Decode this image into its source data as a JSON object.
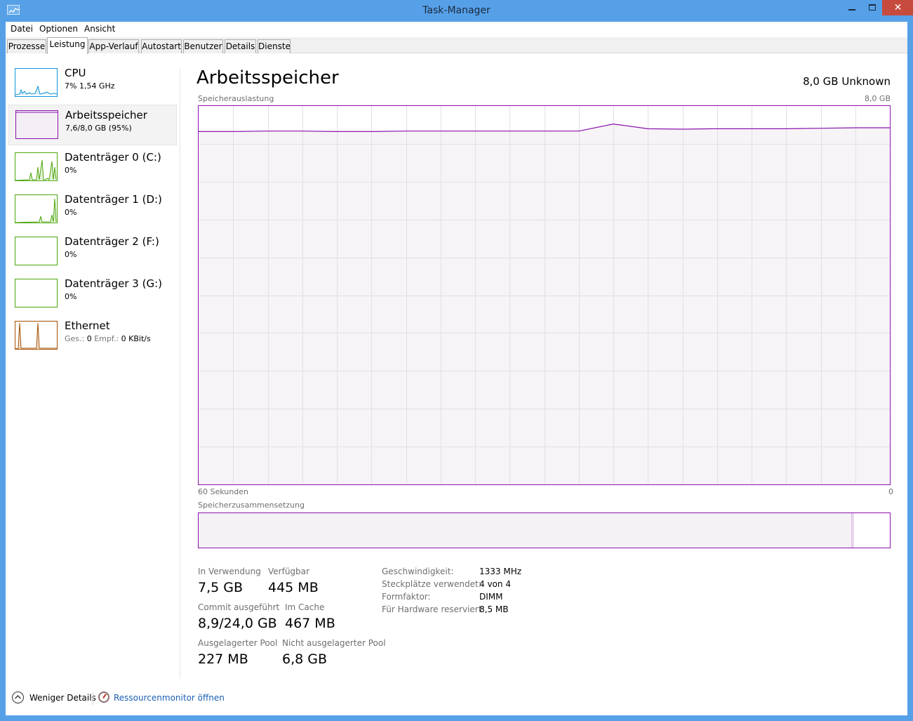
{
  "window": {
    "title": "Task-Manager",
    "close_glyph": "✕"
  },
  "menu": [
    "Datei",
    "Optionen",
    "Ansicht"
  ],
  "tabs": [
    "Prozesse",
    "Leistung",
    "App-Verlauf",
    "Autostart",
    "Benutzer",
    "Details",
    "Dienste"
  ],
  "active_tab": "Leistung",
  "sidebar": [
    {
      "name": "CPU",
      "sub": "7% 1,54 GHz",
      "color": "#1195d4"
    },
    {
      "name": "Arbeitsspeicher",
      "sub": "7,6/8,0 GB (95%)",
      "color": "#8b12ae"
    },
    {
      "name": "Datenträger 0 (C:)",
      "sub": "0%",
      "color": "#4da60c"
    },
    {
      "name": "Datenträger 1 (D:)",
      "sub": "0%",
      "color": "#4da60c"
    },
    {
      "name": "Datenträger 2 (F:)",
      "sub": "0%",
      "color": "#4da60c"
    },
    {
      "name": "Datenträger 3 (G:)",
      "sub": "0%",
      "color": "#4da60c"
    },
    {
      "name": "Ethernet",
      "sub_gray1": "Ges.:",
      "sub_val1": "0",
      "sub_gray2": "Empf.:",
      "sub_val2": "0 KBit/s",
      "color": "#a74f01"
    }
  ],
  "main": {
    "title": "Arbeitsspeicher",
    "capacity": "8,0 GB Unknown",
    "graph_label": "Speicherauslastung",
    "graph_max": "8,0 GB",
    "time_left": "60 Sekunden",
    "time_right": "0",
    "composition_label": "Speicherzusammensetzung",
    "composition_used_fraction": 0.945
  },
  "chart_data": {
    "type": "area",
    "title": "Speicherauslastung",
    "ylim": [
      0,
      8.0
    ],
    "y_unit": "GB",
    "x": [
      60,
      57,
      54,
      51,
      48,
      45,
      42,
      39,
      36,
      33,
      30,
      27,
      24,
      21,
      18,
      15,
      12,
      9,
      6,
      3,
      0
    ],
    "values": [
      7.46,
      7.46,
      7.47,
      7.47,
      7.46,
      7.46,
      7.47,
      7.47,
      7.47,
      7.47,
      7.47,
      7.47,
      7.62,
      7.52,
      7.51,
      7.52,
      7.52,
      7.52,
      7.53,
      7.54,
      7.54
    ],
    "color": "#8b12ae"
  },
  "stats": [
    {
      "label": "In Verwendung",
      "value": "7,5 GB"
    },
    {
      "label": "Verfügbar",
      "value": "445 MB"
    },
    {
      "label": "Commit ausgeführt",
      "value": "8,9/24,0 GB"
    },
    {
      "label": "Im Cache",
      "value": "467 MB"
    },
    {
      "label": "Ausgelagerter Pool",
      "value": "227 MB"
    },
    {
      "label": "Nicht ausgelagerter Pool",
      "value": "6,8 GB"
    }
  ],
  "properties": [
    {
      "key": "Geschwindigkeit:",
      "value": "1333 MHz"
    },
    {
      "key": "Steckplätze verwendet:",
      "value": "4 von 4"
    },
    {
      "key": "Formfaktor:",
      "value": "DIMM"
    },
    {
      "key": "Für Hardware reserviert:",
      "value": "8,5 MB"
    }
  ],
  "footer": {
    "fewer_details": "Weniger Details",
    "resource_monitor": "Ressourcenmonitor öffnen"
  }
}
